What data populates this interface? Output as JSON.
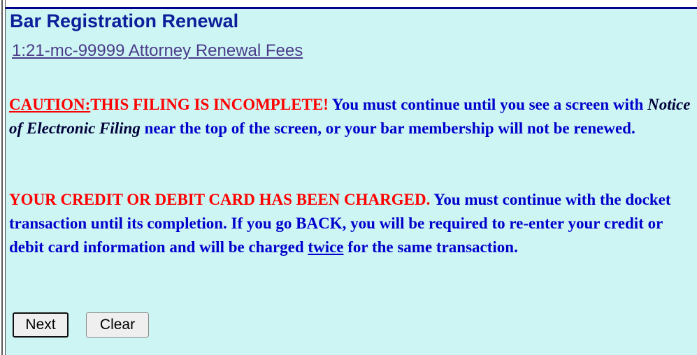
{
  "header": {
    "title": "Bar Registration Renewal",
    "case_link": "1:21-mc-99999 Attorney Renewal Fees"
  },
  "caution": {
    "label": "CAUTION:",
    "headline": "THIS FILING IS INCOMPLETE!",
    "text_before": " You must continue until you see a screen with ",
    "emphasis": "Notice of Electronic Filing",
    "text_after": " near the top of the screen, or your bar membership will not be renewed."
  },
  "charge_warning": {
    "headline": "YOUR CREDIT OR DEBIT CARD HAS BEEN CHARGED.",
    "text_before": " You must continue with the docket transaction until its completion. If you go BACK, you will be required to re-enter your credit or debit card information and will be charged ",
    "link_text": "twice",
    "text_after": " for the same transaction."
  },
  "buttons": {
    "next_label": "Next",
    "clear_label": "Clear"
  },
  "colors": {
    "panel_bg": "#cdf5f3",
    "title_blue": "#0c1f9a",
    "body_blue": "#0000cc",
    "warning_red": "#ff0000",
    "top_border": "#00008b"
  }
}
